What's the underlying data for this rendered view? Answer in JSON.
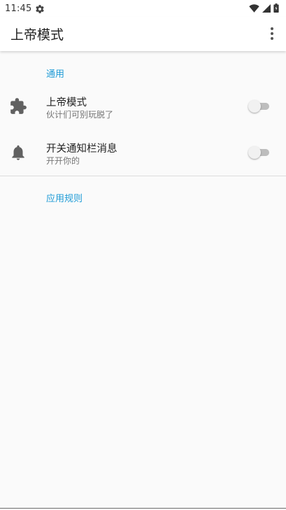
{
  "status_bar": {
    "time": "11:45",
    "icons": [
      "settings-gear-icon",
      "wifi-icon",
      "signal-icon",
      "battery-icon"
    ]
  },
  "app_bar": {
    "title": "上帝模式",
    "overflow_icon": "more-vert-icon"
  },
  "sections": [
    {
      "header": "通用",
      "items": [
        {
          "title": "上帝模式",
          "summary": "伙计们可别玩脱了",
          "icon": "puzzle-icon",
          "enabled": false
        },
        {
          "title": "开关通知栏消息",
          "summary": "开开你的",
          "icon": "bell-icon",
          "enabled": false
        }
      ]
    },
    {
      "header": "应用规则",
      "items": []
    }
  ],
  "colors": {
    "accent": "#1e9bd6",
    "background": "#fafafa",
    "app_bar": "#ffffff",
    "switch_track_off": "#bdbdbd",
    "switch_thumb_off": "#f1f1f1",
    "icon": "#616161"
  }
}
